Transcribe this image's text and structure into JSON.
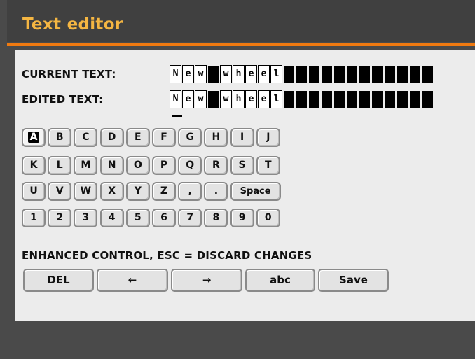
{
  "title": "Text editor",
  "current_label": "CURRENT TEXT:",
  "edited_label": "EDITED TEXT:",
  "current_text": "New wheel",
  "edited_text": "New wheel",
  "text_length": 21,
  "keyboard": {
    "rows": [
      [
        "A",
        "B",
        "C",
        "D",
        "E",
        "F",
        "G",
        "H",
        "I",
        "J"
      ],
      [
        "K",
        "L",
        "M",
        "N",
        "O",
        "P",
        "Q",
        "R",
        "S",
        "T"
      ],
      [
        "U",
        "V",
        "W",
        "X",
        "Y",
        "Z",
        ",",
        ".",
        "Space"
      ],
      [
        "1",
        "2",
        "3",
        "4",
        "5",
        "6",
        "7",
        "8",
        "9",
        "0"
      ]
    ],
    "selected": "A"
  },
  "hint": "ENHANCED CONTROL, ESC = DISCARD CHANGES",
  "buttons": {
    "del": "DEL",
    "left": "←",
    "right": "→",
    "abc": "abc",
    "save": "Save"
  },
  "colors": {
    "title": "#f5b642",
    "accent": "#f07a10",
    "panel": "#ececec",
    "frame": "#4a4a4a"
  }
}
